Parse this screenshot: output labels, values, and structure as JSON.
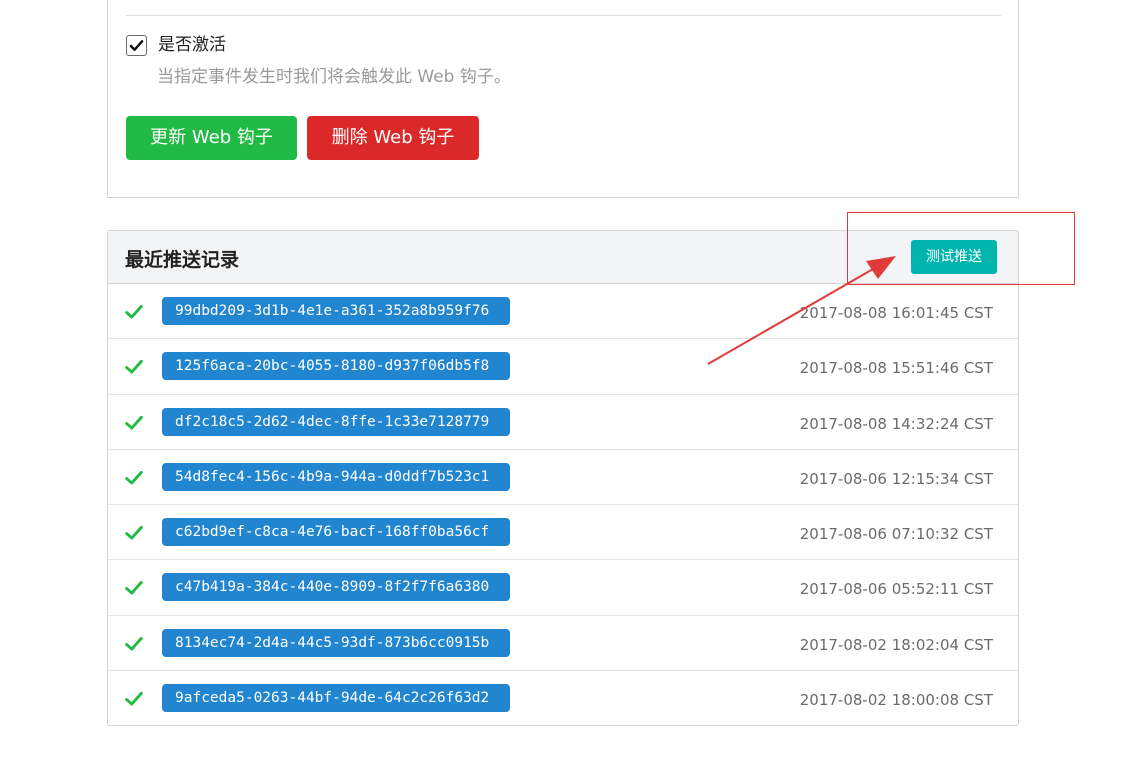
{
  "settings": {
    "active_label": "是否激活",
    "active_help": "当指定事件发生时我们将会触发此 Web 钩子。",
    "active_checked": true,
    "update_button": "更新 Web 钩子",
    "delete_button": "删除 Web 钩子"
  },
  "deliveries": {
    "title": "最近推送记录",
    "test_button": "测试推送",
    "items": [
      {
        "uuid": "99dbd209-3d1b-4e1e-a361-352a8b959f76",
        "time": "2017-08-08 16:01:45 CST",
        "status": "success"
      },
      {
        "uuid": "125f6aca-20bc-4055-8180-d937f06db5f8",
        "time": "2017-08-08 15:51:46 CST",
        "status": "success"
      },
      {
        "uuid": "df2c18c5-2d62-4dec-8ffe-1c33e7128779",
        "time": "2017-08-08 14:32:24 CST",
        "status": "success"
      },
      {
        "uuid": "54d8fec4-156c-4b9a-944a-d0ddf7b523c1",
        "time": "2017-08-06 12:15:34 CST",
        "status": "success"
      },
      {
        "uuid": "c62bd9ef-c8ca-4e76-bacf-168ff0ba56cf",
        "time": "2017-08-06 07:10:32 CST",
        "status": "success"
      },
      {
        "uuid": "c47b419a-384c-440e-8909-8f2f7f6a6380",
        "time": "2017-08-06 05:52:11 CST",
        "status": "success"
      },
      {
        "uuid": "8134ec74-2d4a-44c5-93df-873b6cc0915b",
        "time": "2017-08-02 18:02:04 CST",
        "status": "success"
      },
      {
        "uuid": "9afceda5-0263-44bf-94de-64c2c26f63d2",
        "time": "2017-08-02 18:00:08 CST",
        "status": "success"
      }
    ]
  },
  "colors": {
    "success_green": "#21ba45",
    "danger_red": "#db2828",
    "teal": "#00b5ad",
    "uuid_blue": "#2185d0",
    "annotation_red": "#e03a3a"
  },
  "icons": {
    "checkbox": "checkmark-icon",
    "status": "check-icon"
  }
}
